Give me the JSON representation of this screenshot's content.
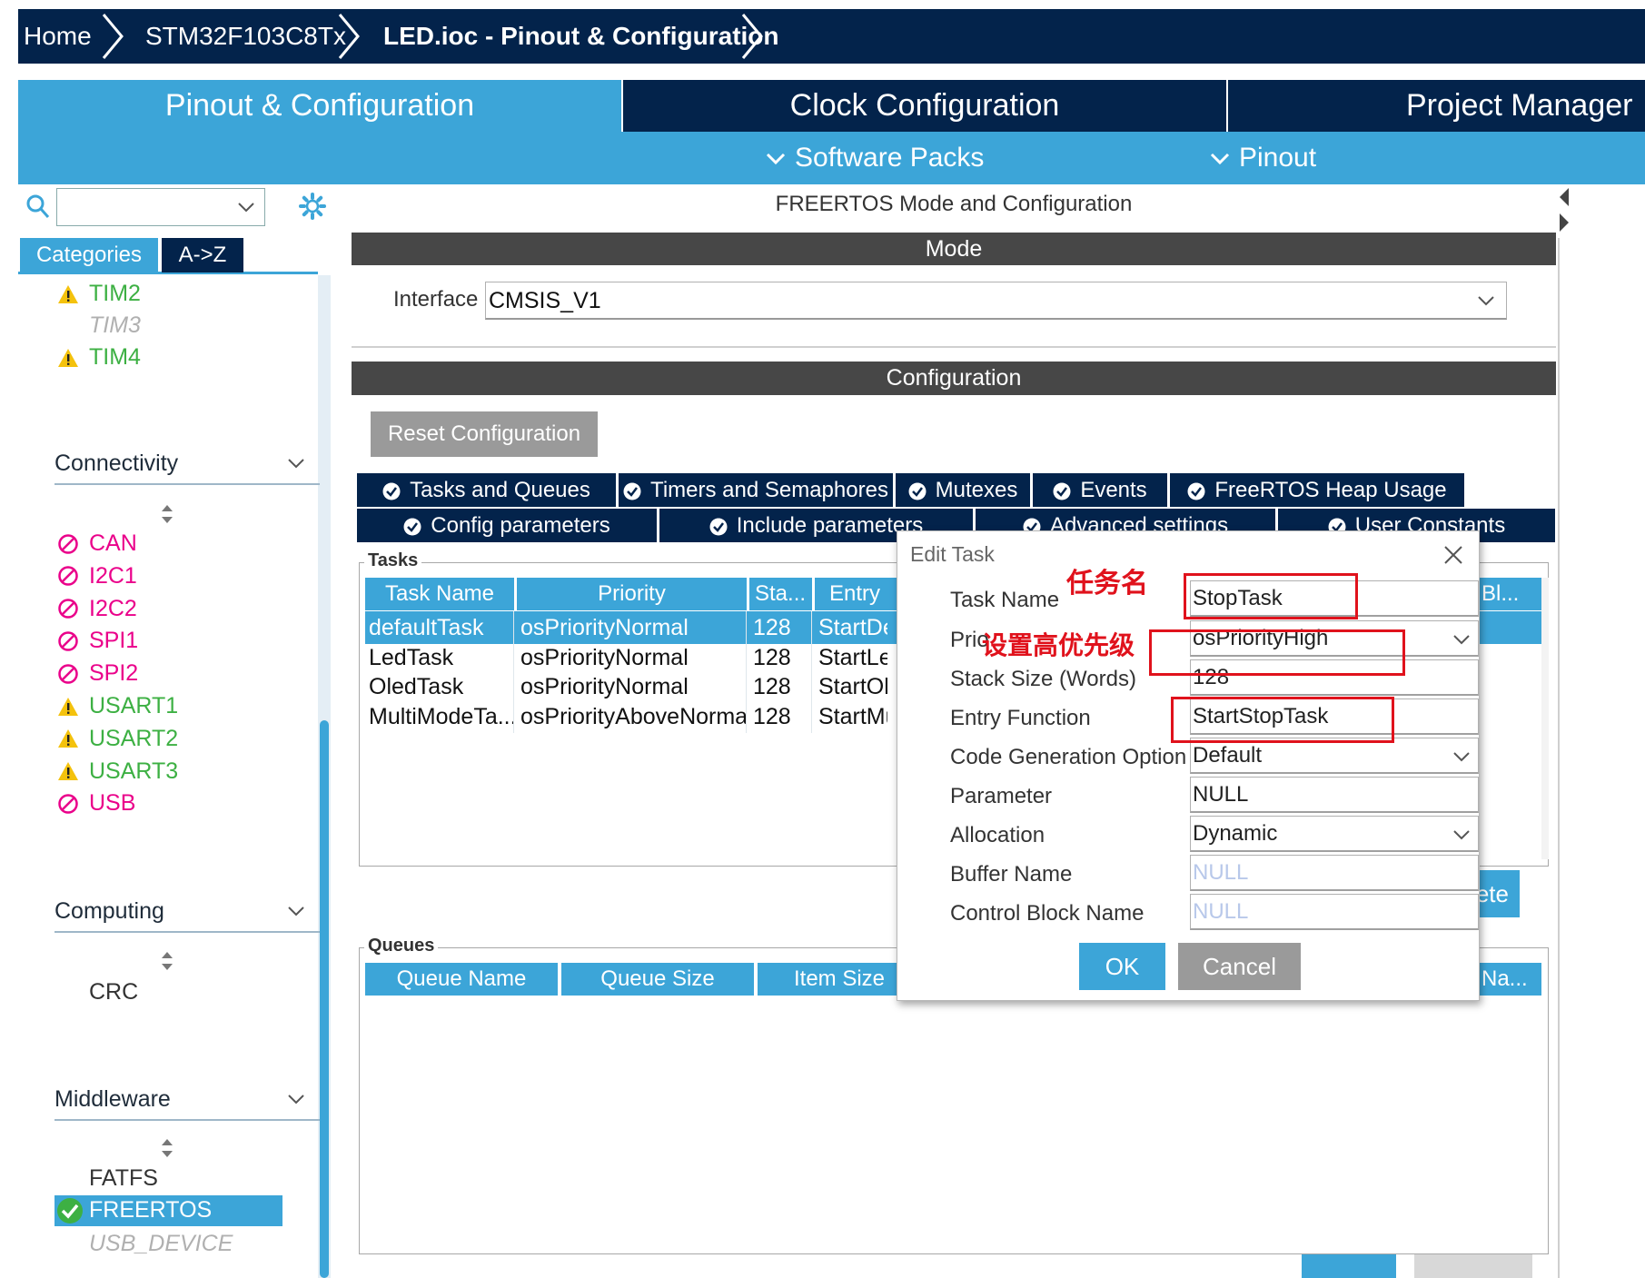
{
  "breadcrumb": {
    "items": [
      {
        "label": "Home"
      },
      {
        "label": "STM32F103C8Tx"
      },
      {
        "label": "LED.ioc - Pinout & Configuration"
      }
    ]
  },
  "main_tabs": {
    "items": [
      {
        "label": "Pinout & Configuration",
        "active": true
      },
      {
        "label": "Clock Configuration",
        "active": false
      },
      {
        "label": "Project Manager",
        "active": false
      }
    ]
  },
  "sub_tabs": {
    "software_packs": "Software Packs",
    "pinout": "Pinout"
  },
  "left": {
    "search_value": "",
    "tab_categories": "Categories",
    "tab_az": "A->Z",
    "timers": [
      {
        "label": "TIM2",
        "state": "warning"
      },
      {
        "label": "TIM3",
        "state": "unavailable"
      },
      {
        "label": "TIM4",
        "state": "warning"
      }
    ],
    "connectivity_title": "Connectivity",
    "connectivity": [
      {
        "label": "CAN",
        "state": "disabled"
      },
      {
        "label": "I2C1",
        "state": "disabled"
      },
      {
        "label": "I2C2",
        "state": "disabled"
      },
      {
        "label": "SPI1",
        "state": "disabled"
      },
      {
        "label": "SPI2",
        "state": "disabled"
      },
      {
        "label": "USART1",
        "state": "warning"
      },
      {
        "label": "USART2",
        "state": "warning"
      },
      {
        "label": "USART3",
        "state": "warning"
      },
      {
        "label": "USB",
        "state": "disabled"
      }
    ],
    "computing_title": "Computing",
    "computing": [
      {
        "label": "CRC"
      }
    ],
    "middleware_title": "Middleware",
    "middleware": [
      {
        "label": "FATFS",
        "state": "normal"
      },
      {
        "label": "FREERTOS",
        "state": "enabled"
      },
      {
        "label": "USB_DEVICE",
        "state": "unavailable"
      }
    ]
  },
  "right": {
    "title": "FREERTOS Mode and Configuration",
    "mode_header": "Mode",
    "interface_label": "Interface",
    "interface_value": "CMSIS_V1",
    "config_header": "Configuration",
    "reset_button": "Reset Configuration",
    "tabs_row1": [
      "Tasks and Queues",
      "Timers and Semaphores",
      "Mutexes",
      "Events",
      "FreeRTOS Heap Usage"
    ],
    "tabs_row2": [
      "Config parameters",
      "Include parameters",
      "Advanced settings",
      "User Constants"
    ],
    "tasks_group": "Tasks",
    "tasks_columns": [
      "Task Name",
      "Priority",
      "Sta...",
      "Entry",
      "l Bl..."
    ],
    "tasks_rows": [
      {
        "name": "defaultTask",
        "priority": "osPriorityNormal",
        "stack": "128",
        "entry": "StartDefaultTask",
        "selected": true
      },
      {
        "name": "LedTask",
        "priority": "osPriorityNormal",
        "stack": "128",
        "entry": "StartLedTask",
        "selected": false
      },
      {
        "name": "OledTask",
        "priority": "osPriorityNormal",
        "stack": "128",
        "entry": "StartOledTask",
        "selected": false
      },
      {
        "name": "MultiModeTa...",
        "priority": "osPriorityAboveNormal",
        "stack": "128",
        "entry": "StartMultiModeTask",
        "selected": false
      }
    ],
    "delete_button_partial": "ete",
    "queues_group": "Queues",
    "queues_columns": [
      "Queue Name",
      "Queue Size",
      "Item Size",
      "Na..."
    ]
  },
  "dialog": {
    "title": "Edit Task",
    "fields": [
      {
        "label": "Task Name",
        "value": "StopTask"
      },
      {
        "label": "Priority",
        "label_visible": "Prio",
        "value": "osPriorityHigh"
      },
      {
        "label": "Stack Size (Words)",
        "value": "128"
      },
      {
        "label": "Entry Function",
        "value": "StartStopTask"
      },
      {
        "label": "Code Generation Option",
        "value": "Default"
      },
      {
        "label": "Parameter",
        "value": "NULL"
      },
      {
        "label": "Allocation",
        "value": "Dynamic"
      },
      {
        "label": "Buffer Name",
        "placeholder": "NULL"
      },
      {
        "label": "Control Block Name",
        "placeholder": "NULL"
      }
    ],
    "ok": "OK",
    "cancel": "Cancel"
  },
  "annotations": {
    "task_name": "任务名",
    "priority": "设置高优先级"
  },
  "colors": {
    "navy": "#03234b",
    "accent": "#3ca5d8",
    "warning": "#3db043",
    "disabled": "#ea008a",
    "dark_header": "#474747",
    "annotation_red": "#e0121c"
  }
}
